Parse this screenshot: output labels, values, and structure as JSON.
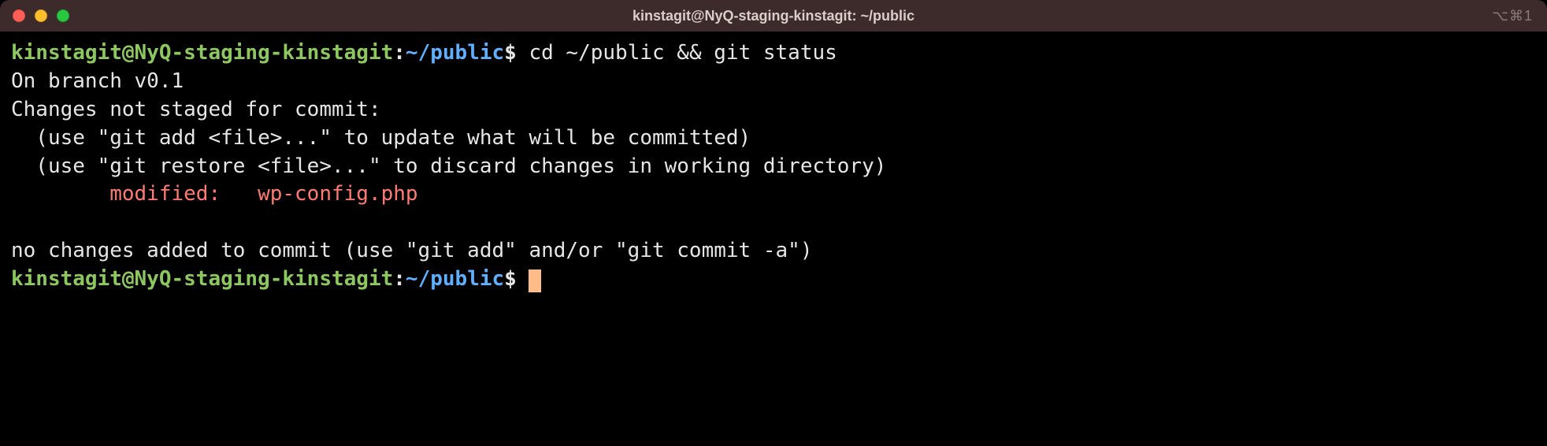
{
  "titlebar": {
    "title": "kinstagit@NyQ-staging-kinstagit: ~/public",
    "right_indicator": "⌥⌘1"
  },
  "prompt1": {
    "user_host": "kinstagit@NyQ-staging-kinstagit",
    "colon": ":",
    "path": "~/public",
    "dollar": "$",
    "command": " cd ~/public && git status"
  },
  "output": {
    "line1": "On branch v0.1",
    "line2": "Changes not staged for commit:",
    "line3": "  (use \"git add <file>...\" to update what will be committed)",
    "line4": "  (use \"git restore <file>...\" to discard changes in working directory)",
    "line5_red": "        modified:   wp-config.php",
    "line6": "",
    "line7": "no changes added to commit (use \"git add\" and/or \"git commit -a\")"
  },
  "prompt2": {
    "user_host": "kinstagit@NyQ-staging-kinstagit",
    "colon": ":",
    "path": "~/public",
    "dollar": "$",
    "command": " "
  }
}
